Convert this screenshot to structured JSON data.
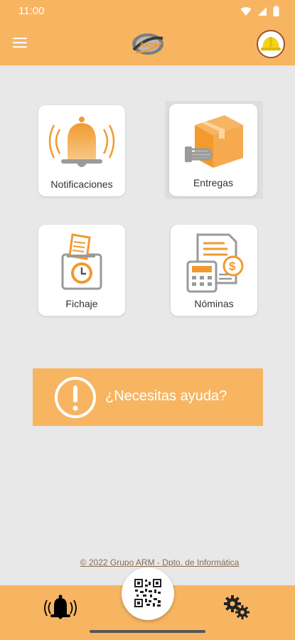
{
  "status_bar": {
    "time": "11:00",
    "icons": [
      "wifi-icon",
      "signal-icon",
      "battery-icon"
    ]
  },
  "app_bar": {
    "menu_icon": "hamburger-menu-icon",
    "logo": "arm-logo",
    "avatar_icon": "hardhat-avatar-icon"
  },
  "tiles": [
    {
      "label": "Notificaciones",
      "icon": "bell-ringing-icon"
    },
    {
      "label": "Entregas",
      "icon": "package-delivery-icon",
      "selected": true
    },
    {
      "label": "Fichaje",
      "icon": "time-clock-card-icon"
    },
    {
      "label": "Nóminas",
      "icon": "payroll-calculator-icon"
    }
  ],
  "help": {
    "label": "¿Necesitas ayuda?",
    "icon": "exclamation-circle-icon"
  },
  "footer": {
    "copyright": "© 2022 Grupo ARM - Dpto. de Informática"
  },
  "bottom_nav": {
    "left_icon": "bell-ringing-icon",
    "center_icon": "qr-code-icon",
    "right_icon": "gears-icon"
  },
  "colors": {
    "primary": "#f7b562",
    "icon_orange": "#f29a2e",
    "icon_gray": "#9a9a9a"
  }
}
